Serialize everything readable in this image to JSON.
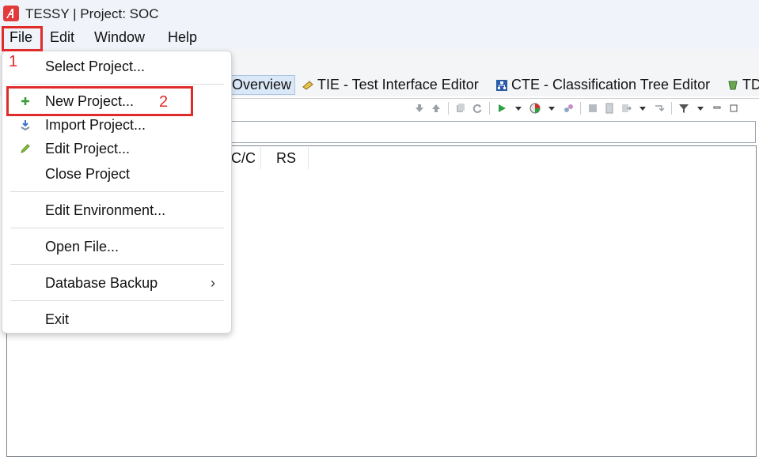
{
  "window": {
    "title": "TESSY | Project: SOC"
  },
  "menubar": {
    "items": [
      "File",
      "Edit",
      "Window",
      "Help"
    ]
  },
  "perspectives": [
    {
      "label": "Overview",
      "icon": "overview-icon"
    },
    {
      "label": "TIE - Test Interface Editor",
      "icon": "tie-icon"
    },
    {
      "label": "CTE - Classification Tree Editor",
      "icon": "cte-icon"
    },
    {
      "label": "TD",
      "icon": "td-icon"
    }
  ],
  "table": {
    "columns": [
      "C/C",
      "RS"
    ]
  },
  "file_menu": {
    "items": [
      {
        "label": "Select Project...",
        "icon": ""
      },
      {
        "label": "New Project...",
        "icon": "plus-icon"
      },
      {
        "label": "Import Project...",
        "icon": "import-icon"
      },
      {
        "label": "Edit Project...",
        "icon": "pencil-icon"
      },
      {
        "label": "Close Project",
        "icon": ""
      },
      {
        "label": "Edit Environment...",
        "icon": ""
      },
      {
        "label": "Open File...",
        "icon": ""
      },
      {
        "label": "Database Backup",
        "icon": "",
        "submenu_arrow": "›"
      },
      {
        "label": "Exit",
        "icon": ""
      }
    ]
  },
  "annotations": {
    "step1": "1",
    "step2": "2"
  },
  "colors": {
    "annotation_red": "#e02b2b",
    "active_tab_bg": "#dbe8f8"
  }
}
